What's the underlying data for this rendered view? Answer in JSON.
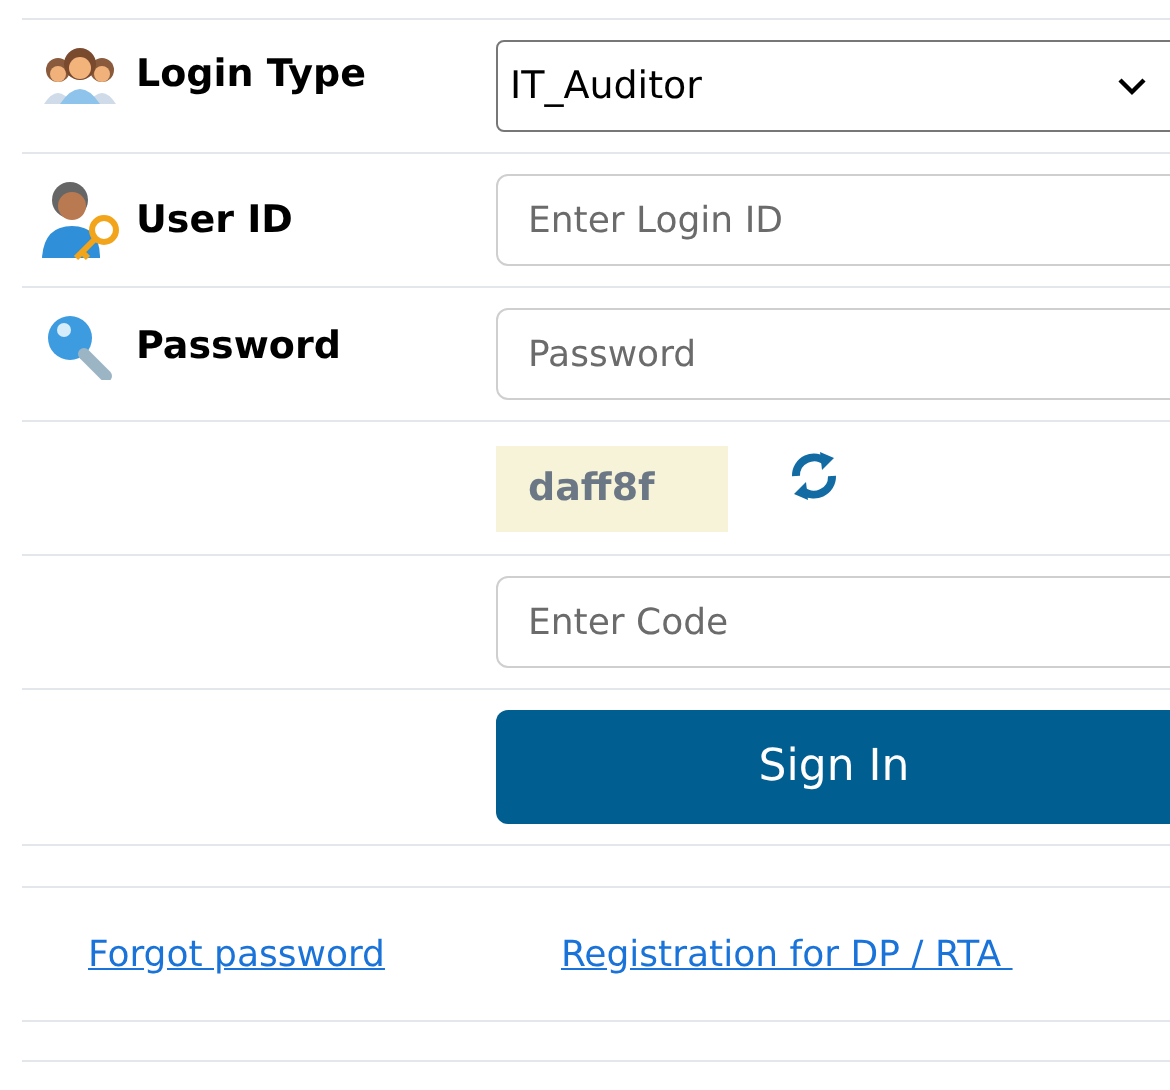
{
  "fields": [
    {
      "kind": "select",
      "label": "Login Type",
      "value": "IT_Auditor"
    },
    {
      "kind": "input",
      "label": "User ID",
      "placeholder": "Enter Login ID"
    },
    {
      "kind": "input",
      "label": "Password",
      "placeholder": "Password"
    },
    {
      "kind": "captcha",
      "code": "daff8f"
    },
    {
      "kind": "input",
      "placeholder": "Enter Code"
    }
  ],
  "sign_in": "Sign In",
  "links": [
    "Forgot password",
    "Registration for DP / RTA "
  ]
}
